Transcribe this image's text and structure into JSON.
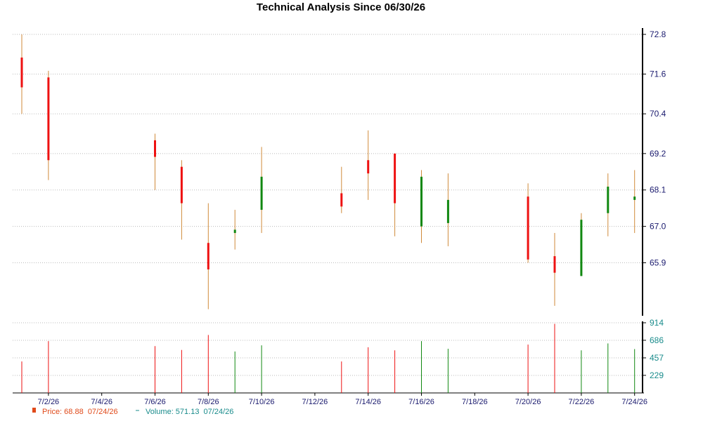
{
  "chart_data": {
    "type": "candlestick",
    "title": "Technical Analysis Since 06/30/26",
    "price_axis": {
      "ticks": [
        "72.8",
        "71.6",
        "70.4",
        "69.2",
        "68.1",
        "67.0",
        "65.9"
      ],
      "range": [
        64.3,
        72.8
      ]
    },
    "volume_axis": {
      "ticks": [
        "914",
        "686",
        "457",
        "229"
      ],
      "range": [
        0,
        914
      ]
    },
    "x_labels": [
      "7/2/26",
      "7/4/26",
      "7/6/26",
      "7/8/26",
      "7/10/26",
      "7/12/26",
      "7/14/26",
      "7/16/26",
      "7/18/26",
      "7/20/26",
      "7/22/26",
      "7/24/26"
    ],
    "x_label_days": [
      2,
      4,
      6,
      8,
      10,
      12,
      14,
      16,
      18,
      20,
      22,
      24
    ],
    "x_start_day": 1,
    "grid": true,
    "legend_position": "bottom-left",
    "colors": {
      "up": "#118811",
      "down": "#ee1111",
      "wick": "#d08a3a",
      "grid": "#bbbbbb",
      "axis": "#000000"
    },
    "candles": [
      {
        "date": "7/1/26",
        "day": 1,
        "open": 72.1,
        "high": 72.8,
        "low": 70.4,
        "close": 71.2,
        "volume": 410
      },
      {
        "date": "7/2/26",
        "day": 2,
        "open": 71.5,
        "high": 71.7,
        "low": 68.4,
        "close": 69.0,
        "volume": 675
      },
      {
        "date": "7/6/26",
        "day": 6,
        "open": 69.6,
        "high": 69.8,
        "low": 68.1,
        "close": 69.1,
        "volume": 610
      },
      {
        "date": "7/7/26",
        "day": 7,
        "open": 68.8,
        "high": 69.0,
        "low": 66.6,
        "close": 67.7,
        "volume": 560
      },
      {
        "date": "7/8/26",
        "day": 8,
        "open": 66.5,
        "high": 67.7,
        "low": 64.5,
        "close": 65.7,
        "volume": 755
      },
      {
        "date": "7/9/26",
        "day": 9,
        "open": 66.8,
        "high": 67.5,
        "low": 66.3,
        "close": 66.9,
        "volume": 540
      },
      {
        "date": "7/10/26",
        "day": 10,
        "open": 67.5,
        "high": 69.4,
        "low": 66.8,
        "close": 68.5,
        "volume": 620
      },
      {
        "date": "7/13/26",
        "day": 13,
        "open": 68.0,
        "high": 68.8,
        "low": 67.4,
        "close": 67.6,
        "volume": 410
      },
      {
        "date": "7/14/26",
        "day": 14,
        "open": 69.0,
        "high": 69.9,
        "low": 67.8,
        "close": 68.6,
        "volume": 595
      },
      {
        "date": "7/15/26",
        "day": 15,
        "open": 69.2,
        "high": 69.2,
        "low": 66.7,
        "close": 67.7,
        "volume": 555
      },
      {
        "date": "7/16/26",
        "day": 16,
        "open": 67.0,
        "high": 68.7,
        "low": 66.5,
        "close": 68.5,
        "volume": 675
      },
      {
        "date": "7/17/26",
        "day": 17,
        "open": 67.1,
        "high": 68.6,
        "low": 66.4,
        "close": 67.8,
        "volume": 575
      },
      {
        "date": "7/20/26",
        "day": 20,
        "open": 67.9,
        "high": 68.3,
        "low": 65.9,
        "close": 66.0,
        "volume": 630
      },
      {
        "date": "7/21/26",
        "day": 21,
        "open": 66.1,
        "high": 66.8,
        "low": 64.6,
        "close": 65.6,
        "volume": 900
      },
      {
        "date": "7/22/26",
        "day": 22,
        "open": 65.5,
        "high": 67.4,
        "low": 65.5,
        "close": 67.2,
        "volume": 555
      },
      {
        "date": "7/23/26",
        "day": 23,
        "open": 67.4,
        "high": 68.6,
        "low": 66.7,
        "close": 68.2,
        "volume": 645
      },
      {
        "date": "7/24/26",
        "day": 24,
        "open": 67.8,
        "high": 68.7,
        "low": 66.8,
        "close": 67.9,
        "volume": 571.13
      }
    ]
  },
  "legend": {
    "price_text": "Price: 68.88  07/24/26",
    "volume_text": "Volume: 571.13  07/24/26",
    "price_icon": "price-marker-icon",
    "volume_icon": "volume-dash-icon"
  }
}
